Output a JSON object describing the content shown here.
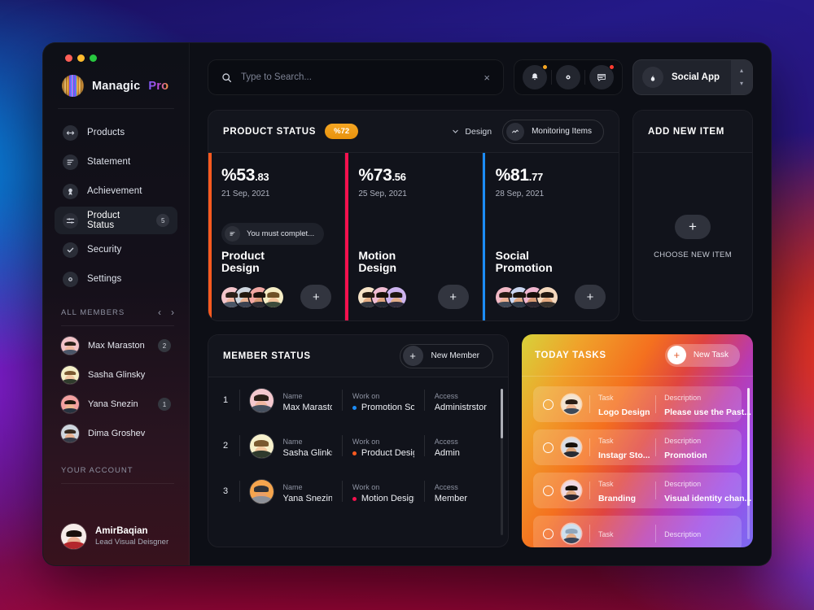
{
  "brand": {
    "name": "Managic",
    "suffix": "Pro"
  },
  "sidebar": {
    "nav": [
      {
        "label": "Products",
        "icon": "products-icon",
        "badge": ""
      },
      {
        "label": "Statement",
        "icon": "statement-icon",
        "badge": ""
      },
      {
        "label": "Achievement",
        "icon": "achievement-icon",
        "badge": ""
      },
      {
        "label": "Product Status",
        "icon": "product-status-icon",
        "badge": "5"
      },
      {
        "label": "Security",
        "icon": "security-icon",
        "badge": ""
      },
      {
        "label": "Settings",
        "icon": "settings-icon",
        "badge": ""
      }
    ],
    "members_section_title": "ALL MEMBERS",
    "members": [
      {
        "name": "Max Maraston",
        "badge": "2"
      },
      {
        "name": "Sasha Glinsky",
        "badge": ""
      },
      {
        "name": "Yana Snezin",
        "badge": "1"
      },
      {
        "name": "Dima Groshev",
        "badge": ""
      }
    ],
    "account_section_title": "YOUR ACCOUNT",
    "account": {
      "name": "AmirBaqian",
      "role": "Lead Visual Deisgner"
    }
  },
  "topbar": {
    "search_placeholder": "Type to Search...",
    "search_value": "",
    "clear_label": "×",
    "icons": [
      {
        "name": "notification-bell-icon",
        "dot": "#f5a623"
      },
      {
        "name": "settings-gear-icon",
        "dot": ""
      },
      {
        "name": "messages-icon",
        "dot": "#ff3b30"
      }
    ],
    "app_selector": {
      "label": "Social App",
      "icon": "flame-icon",
      "up": "▴",
      "down": "▾"
    }
  },
  "product_status": {
    "title": "PRODUCT STATUS",
    "badge": "%72",
    "filter_label": "Design",
    "monitor_label": "Monitoring Items",
    "columns": [
      {
        "percent_int": "%53",
        "percent_dec": ".83",
        "date": "21 Sep, 2021",
        "note": "You must complet...",
        "name": "Product\nDesign",
        "bar_color": "#ff5a1f",
        "avatars": 4,
        "add_label": "+"
      },
      {
        "percent_int": "%73",
        "percent_dec": ".56",
        "date": "25 Sep, 2021",
        "note": "",
        "name": "Motion\nDesign",
        "bar_color": "#f5114e",
        "avatars": 3,
        "add_label": "+"
      },
      {
        "percent_int": "%81",
        "percent_dec": ".77",
        "date": "28 Sep, 2021",
        "note": "",
        "name": "Social\nPromotion",
        "bar_color": "#1c8cf5",
        "avatars": 4,
        "add_label": "+"
      }
    ]
  },
  "add_new_item": {
    "title": "ADD NEW ITEM",
    "plus_label": "+",
    "caption": "CHOOSE NEW ITEM"
  },
  "member_status": {
    "title": "MEMBER STATUS",
    "new_member_label": "New Member",
    "new_member_plus": "+",
    "column_labels": {
      "name": "Name",
      "work": "Work on",
      "access": "Access"
    },
    "rows": [
      {
        "num": "1",
        "name": "Max Maraston",
        "work": "Promotion So...",
        "work_color": "#1c8cf5",
        "access": "Administrstor"
      },
      {
        "num": "2",
        "name": "Sasha Glinksky",
        "work": "Product Design",
        "work_color": "#ff5a1f",
        "access": "Admin"
      },
      {
        "num": "3",
        "name": "Yana Snezin",
        "work": "Motion Design",
        "work_color": "#f5114e",
        "access": "Member"
      }
    ]
  },
  "today_tasks": {
    "title": "TODAY TASKS",
    "new_task_label": "New Task",
    "new_task_plus": "+",
    "column_labels": {
      "task": "Task",
      "description": "Description"
    },
    "rows": [
      {
        "task": "Logo Design",
        "description": "Please use the Past..."
      },
      {
        "task": "Instagr Sto...",
        "description": "Promotion"
      },
      {
        "task": "Branding",
        "description": "Visual identity chan..."
      },
      {
        "task": "",
        "description": ""
      }
    ]
  },
  "colors": {
    "accent_orange": "#f5a623",
    "bar_orange": "#ff5a1f",
    "bar_pink": "#f5114e",
    "bar_blue": "#1c8cf5"
  }
}
